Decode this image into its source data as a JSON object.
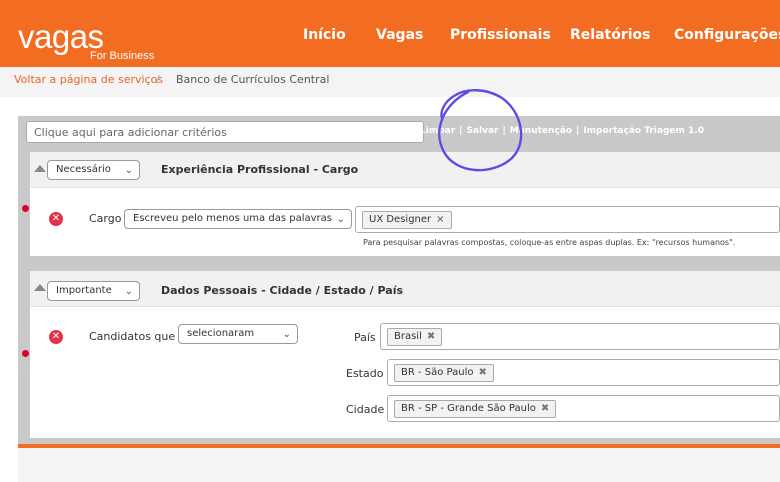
{
  "header": {
    "logo_main": "vagas",
    "logo_sub": "For Business",
    "nav": [
      "Início",
      "Vagas",
      "Profissionais",
      "Relatórios",
      "Configurações"
    ]
  },
  "breadcrumb": {
    "back_link": "Voltar a página de serviços",
    "separator": "/",
    "current": "Banco de Currículos Central"
  },
  "toolbar": {
    "criteria_placeholder": "Clique aqui para adicionar critérios",
    "links": [
      "Limpar",
      "Salvar",
      "Manutenção",
      "Importação Triagem 1.0"
    ],
    "separator": "|"
  },
  "block1": {
    "priority": "Necessário",
    "title": "Experiência Profissional - Cargo",
    "field_label": "Cargo",
    "match_mode": "Escreveu pelo menos uma das palavras",
    "tags": [
      "UX Designer"
    ],
    "hint": "Para pesquisar palavras compostas, coloque-as entre aspas duplas. Ex: \"recursos humanos\"."
  },
  "block2": {
    "priority": "Importante",
    "title": "Dados Pessoais - Cidade / Estado / País",
    "field_label": "Candidatos que",
    "match_mode": "selecionaram",
    "pais_label": "País",
    "pais_tag": "Brasil",
    "estado_label": "Estado",
    "estado_tag": "BR - São Paulo",
    "cidade_label": "Cidade",
    "cidade_tag": "BR - SP - Grande São Paulo"
  },
  "colors": {
    "brand_orange": "#f26d21",
    "remove_red": "#e0334a",
    "link_orange": "#e8652a",
    "annotation_purple": "#5a4fe0"
  },
  "icons": {
    "collapse": "triangle-up-icon",
    "remove": "close-circle-icon",
    "dropdown": "chevron-down-icon",
    "tag_remove": "x-icon"
  }
}
